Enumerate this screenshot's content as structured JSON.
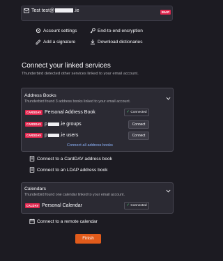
{
  "account": {
    "name": "Test",
    "email_prefix": "test@",
    "email_suffix": ".ie",
    "badge": "IMAP"
  },
  "actions": {
    "account_settings": "Account settings",
    "end_to_end": "End-to-end encryption",
    "add_signature": "Add a signature",
    "download_dictionaries": "Download dictionaries"
  },
  "linked": {
    "title": "Connect your linked services",
    "subtitle": "Thunderbird detected other services linked to your email account."
  },
  "address_books": {
    "title": "Address Books",
    "subtitle": "Thunderbird found 3 address books linked to your email account.",
    "badge": "CARDDAV",
    "items": [
      {
        "label": "Personal Address Book",
        "status": "Connected"
      },
      {
        "label_prefix": "p",
        "label_suffix": ".ie groups",
        "status": "Connect"
      },
      {
        "label_prefix": "p",
        "label_suffix": ".ie users",
        "status": "Connect"
      }
    ],
    "connect_all": "Connect all address books"
  },
  "extra_address": {
    "carddav": "Connect to a CardDAV address book",
    "ldap": "Connect to an LDAP address book"
  },
  "calendars": {
    "title": "Calendars",
    "subtitle": "Thunderbird found one calendar linked to your email account.",
    "badge": "CALDAV",
    "items": [
      {
        "label": "Personal Calendar",
        "status": "Connected"
      }
    ]
  },
  "remote_calendar": "Connect to a remote calendar",
  "finish": "Finish",
  "colors": {
    "background": "#1c1b22",
    "panel": "#2b2a33",
    "badge": "#e22850",
    "finish": "#e15b1b",
    "link": "#8fb6ff",
    "connected_check": "#4fd17a"
  }
}
